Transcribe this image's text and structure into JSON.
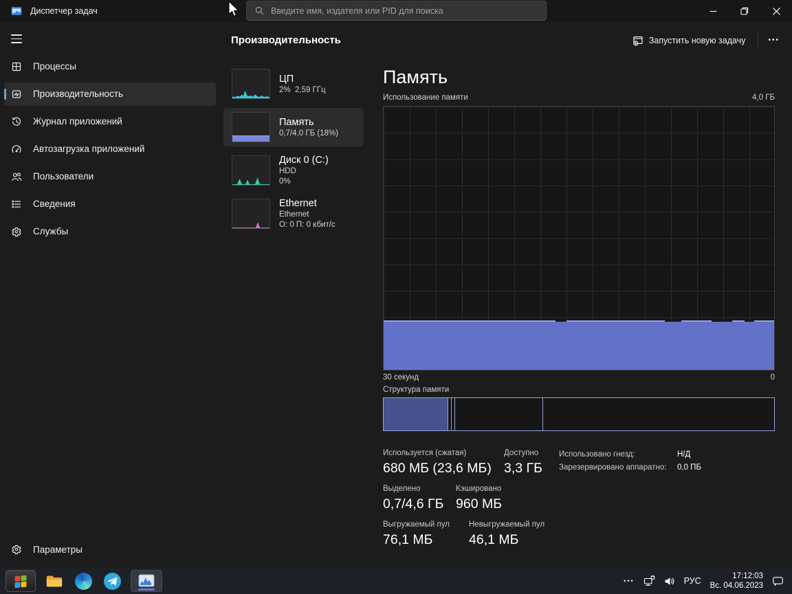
{
  "window": {
    "title": "Диспетчер задач",
    "search_placeholder": "Введите имя, издателя или PID для поиска"
  },
  "sidebar": {
    "items": [
      {
        "label": "Процессы"
      },
      {
        "label": "Производительность",
        "selected": true
      },
      {
        "label": "Журнал приложений"
      },
      {
        "label": "Автозагрузка приложений"
      },
      {
        "label": "Пользователи"
      },
      {
        "label": "Сведения"
      },
      {
        "label": "Службы"
      }
    ],
    "settings_label": "Параметры"
  },
  "header": {
    "title": "Производительность",
    "run_task_label": "Запустить новую задачу",
    "more_label": "•••"
  },
  "cards": [
    {
      "title": "ЦП",
      "sub": "2%  2,59 ГГц"
    },
    {
      "title": "Память",
      "sub": "0,7/4,0 ГБ (18%)",
      "selected": true
    },
    {
      "title": "Диск 0 (C:)",
      "sub": "HDD",
      "sub2": "0%"
    },
    {
      "title": "Ethernet",
      "sub": "Ethernet",
      "sub2": "О: 0 П: 0 кбит/с"
    }
  ],
  "memory": {
    "title": "Память",
    "usage_label": "Использование памяти",
    "max_label": "4,0 ГБ",
    "time_label": "30 секунд",
    "zero_label": "0",
    "composition_label": "Структура памяти",
    "stats": [
      {
        "label": "Используется (сжатая)",
        "value": "680 МБ (23,6 МБ)"
      },
      {
        "label": "Доступно",
        "value": "3,3 ГБ"
      },
      {
        "label": "Выделено",
        "value": "0,7/4,6 ГБ"
      },
      {
        "label": "Кэшировано",
        "value": "960 МБ"
      },
      {
        "label": "Выгружаемый пул",
        "value": "76,1 МБ"
      },
      {
        "label": "Невыгружаемый пул",
        "value": "46,1 МБ"
      }
    ],
    "details": [
      {
        "label": "Использовано гнезд:",
        "value": "Н/Д"
      },
      {
        "label": "Зарезервировано аппаратно:",
        "value": "0,0 ПБ"
      }
    ]
  },
  "chart_data": {
    "type": "area",
    "title": "Использование памяти",
    "xlabel_left": "30 секунд",
    "xlabel_right": "0",
    "ylim_gb": [
      0,
      4.0
    ],
    "x_seconds": [
      30,
      28,
      26,
      24,
      22,
      20,
      18,
      16,
      14,
      12,
      10,
      8,
      6,
      4,
      2,
      0
    ],
    "usage_gb": [
      0.73,
      0.73,
      0.73,
      0.73,
      0.73,
      0.73,
      0.71,
      0.73,
      0.73,
      0.73,
      0.71,
      0.73,
      0.71,
      0.72,
      0.71,
      0.73
    ],
    "usage_percent": 18,
    "composition_fractions": {
      "in_use": 0.163,
      "modified": 0.012,
      "standby": 0.23,
      "free": 0.595
    }
  },
  "taskbar": {
    "tray_more": "•••",
    "language": "РУС",
    "time": "17:12:03",
    "date": "Вс. 04.06.2023"
  },
  "colors": {
    "chart_fill": "#6372c8",
    "chart_border_light": "#97a2e0",
    "composition_in_use": "#47518b",
    "cpu_spark": "#39c7d8",
    "disk_spark": "#3fc7a9",
    "ethernet_spark": "#d873c8",
    "selection_pill": "#6c9fc9",
    "taskbar_bg": "#1d2127"
  }
}
